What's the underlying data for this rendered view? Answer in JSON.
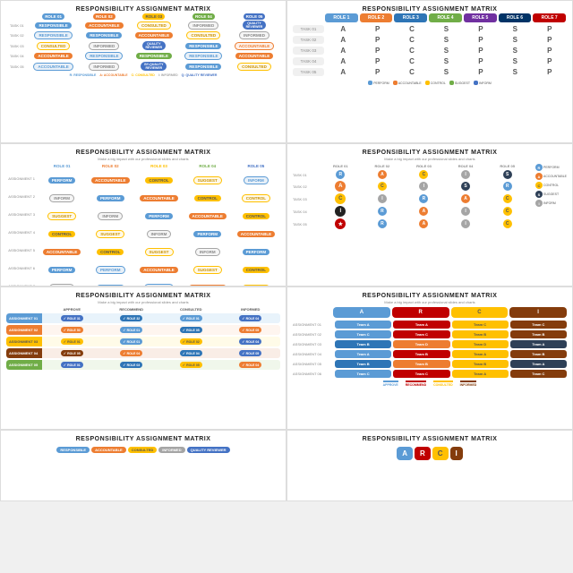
{
  "cells": [
    {
      "id": "cell1",
      "title": "RESPONSIBILITY ASSIGNMENT MATRIX",
      "subtitle": "",
      "type": "raciq-pills"
    },
    {
      "id": "cell2",
      "title": "RESPONSIBILITY ASSIGNMENT MATRIX",
      "subtitle": "",
      "type": "apcs-grid"
    },
    {
      "id": "cell3",
      "title": "RESPONSIBILITY ASSIGNMENT MATRIX",
      "subtitle": "Make a big impact with our professional slides and charts",
      "type": "pill-grid"
    },
    {
      "id": "cell4",
      "title": "RESPONSIBILITY ASSIGNMENT MATRIX",
      "subtitle": "Make a big impact with our professional slides and charts",
      "type": "icon-grid"
    },
    {
      "id": "cell5",
      "title": "RESPONSIBILITY ASSIGNMENT MATRIX",
      "subtitle": "Make a big impact with our professional slides and charts",
      "type": "checkbox-grid"
    },
    {
      "id": "cell6",
      "title": "RESPONSIBILITY ASSIGNMENT MATRIX",
      "subtitle": "Make a big impact with our professional slides and charts",
      "type": "team-grid"
    },
    {
      "id": "cell7",
      "title": "RESPONSIBILITY ASSIGNMENT MATRIX",
      "subtitle": "",
      "type": "partial"
    },
    {
      "id": "cell8",
      "title": "RESPONSIBILITY ASSIGNMENT MATRIX",
      "subtitle": "",
      "type": "partial"
    }
  ],
  "legend": {
    "r": "R: RESPONSIBLE",
    "a": "A: ACCOUNTABLE",
    "c": "C: CONSULTED",
    "i": "I: INFORMED",
    "q": "Q: QUALITY REVIEWER"
  }
}
